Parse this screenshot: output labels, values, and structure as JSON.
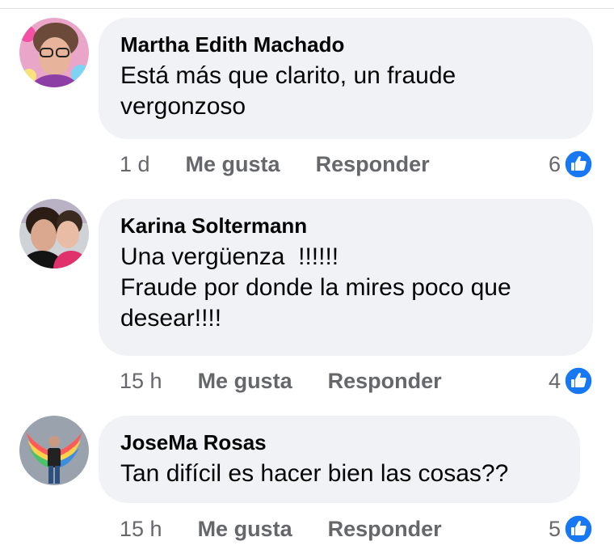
{
  "colors": {
    "bubble": "#f0f2f5",
    "meta_text": "#65676b",
    "like_blue": "#1877f2"
  },
  "comments": [
    {
      "author": "Martha Edith Machado",
      "text": "Está más que clarito, un fraude\nvergonzoso",
      "time": "1 d",
      "like_label": "Me gusta",
      "reply_label": "Responder",
      "reaction_count": "6",
      "reaction_icon": "thumbs-up-icon"
    },
    {
      "author": "Karina Soltermann",
      "text": "Una vergüenza  !!!!!!\nFraude por donde la mires poco que\ndesear!!!!",
      "time": "15 h",
      "like_label": "Me gusta",
      "reply_label": "Responder",
      "reaction_count": "4",
      "reaction_icon": "thumbs-up-icon"
    },
    {
      "author": "JoseMa Rosas",
      "text": "Tan difícil es hacer bien las cosas??",
      "time": "15 h",
      "like_label": "Me gusta",
      "reply_label": "Responder",
      "reaction_count": "5",
      "reaction_icon": "thumbs-up-icon"
    }
  ]
}
